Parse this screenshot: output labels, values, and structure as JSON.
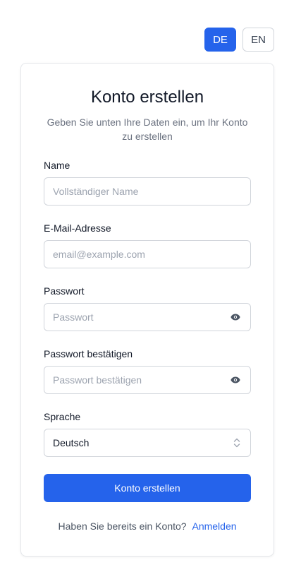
{
  "language_switch": {
    "options": [
      {
        "label": "DE",
        "active": true
      },
      {
        "label": "EN",
        "active": false
      }
    ]
  },
  "card": {
    "title": "Konto erstellen",
    "subtitle": "Geben Sie unten Ihre Daten ein, um Ihr Konto zu erstellen"
  },
  "form": {
    "name": {
      "label": "Name",
      "placeholder": "Vollständiger Name",
      "value": ""
    },
    "email": {
      "label": "E-Mail-Adresse",
      "placeholder": "email@example.com",
      "value": ""
    },
    "password": {
      "label": "Passwort",
      "placeholder": "Passwort",
      "value": "",
      "icon": "eye-icon"
    },
    "password_confirm": {
      "label": "Passwort bestätigen",
      "placeholder": "Passwort bestätigen",
      "value": "",
      "icon": "eye-icon"
    },
    "language": {
      "label": "Sprache",
      "selected": "Deutsch",
      "icon": "chevron-up-down-icon"
    },
    "submit_label": "Konto erstellen"
  },
  "footer": {
    "prompt": "Haben Sie bereits ein Konto?",
    "link_label": "Anmelden"
  },
  "colors": {
    "accent": "#2563eb",
    "border": "#d1d5db",
    "muted_text": "#6b7280"
  }
}
